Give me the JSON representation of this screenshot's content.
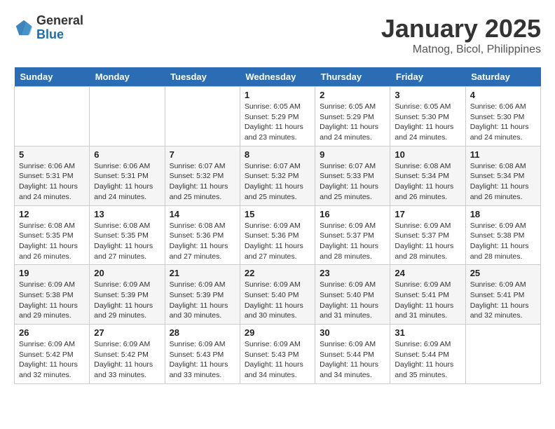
{
  "header": {
    "logo": {
      "line1": "General",
      "line2": "Blue"
    },
    "title": "January 2025",
    "location": "Matnog, Bicol, Philippines"
  },
  "weekdays": [
    "Sunday",
    "Monday",
    "Tuesday",
    "Wednesday",
    "Thursday",
    "Friday",
    "Saturday"
  ],
  "weeks": [
    [
      {
        "day": "",
        "sunrise": "",
        "sunset": "",
        "daylight": ""
      },
      {
        "day": "",
        "sunrise": "",
        "sunset": "",
        "daylight": ""
      },
      {
        "day": "",
        "sunrise": "",
        "sunset": "",
        "daylight": ""
      },
      {
        "day": "1",
        "sunrise": "Sunrise: 6:05 AM",
        "sunset": "Sunset: 5:29 PM",
        "daylight": "Daylight: 11 hours and 23 minutes."
      },
      {
        "day": "2",
        "sunrise": "Sunrise: 6:05 AM",
        "sunset": "Sunset: 5:29 PM",
        "daylight": "Daylight: 11 hours and 24 minutes."
      },
      {
        "day": "3",
        "sunrise": "Sunrise: 6:05 AM",
        "sunset": "Sunset: 5:30 PM",
        "daylight": "Daylight: 11 hours and 24 minutes."
      },
      {
        "day": "4",
        "sunrise": "Sunrise: 6:06 AM",
        "sunset": "Sunset: 5:30 PM",
        "daylight": "Daylight: 11 hours and 24 minutes."
      }
    ],
    [
      {
        "day": "5",
        "sunrise": "Sunrise: 6:06 AM",
        "sunset": "Sunset: 5:31 PM",
        "daylight": "Daylight: 11 hours and 24 minutes."
      },
      {
        "day": "6",
        "sunrise": "Sunrise: 6:06 AM",
        "sunset": "Sunset: 5:31 PM",
        "daylight": "Daylight: 11 hours and 24 minutes."
      },
      {
        "day": "7",
        "sunrise": "Sunrise: 6:07 AM",
        "sunset": "Sunset: 5:32 PM",
        "daylight": "Daylight: 11 hours and 25 minutes."
      },
      {
        "day": "8",
        "sunrise": "Sunrise: 6:07 AM",
        "sunset": "Sunset: 5:32 PM",
        "daylight": "Daylight: 11 hours and 25 minutes."
      },
      {
        "day": "9",
        "sunrise": "Sunrise: 6:07 AM",
        "sunset": "Sunset: 5:33 PM",
        "daylight": "Daylight: 11 hours and 25 minutes."
      },
      {
        "day": "10",
        "sunrise": "Sunrise: 6:08 AM",
        "sunset": "Sunset: 5:34 PM",
        "daylight": "Daylight: 11 hours and 26 minutes."
      },
      {
        "day": "11",
        "sunrise": "Sunrise: 6:08 AM",
        "sunset": "Sunset: 5:34 PM",
        "daylight": "Daylight: 11 hours and 26 minutes."
      }
    ],
    [
      {
        "day": "12",
        "sunrise": "Sunrise: 6:08 AM",
        "sunset": "Sunset: 5:35 PM",
        "daylight": "Daylight: 11 hours and 26 minutes."
      },
      {
        "day": "13",
        "sunrise": "Sunrise: 6:08 AM",
        "sunset": "Sunset: 5:35 PM",
        "daylight": "Daylight: 11 hours and 27 minutes."
      },
      {
        "day": "14",
        "sunrise": "Sunrise: 6:08 AM",
        "sunset": "Sunset: 5:36 PM",
        "daylight": "Daylight: 11 hours and 27 minutes."
      },
      {
        "day": "15",
        "sunrise": "Sunrise: 6:09 AM",
        "sunset": "Sunset: 5:36 PM",
        "daylight": "Daylight: 11 hours and 27 minutes."
      },
      {
        "day": "16",
        "sunrise": "Sunrise: 6:09 AM",
        "sunset": "Sunset: 5:37 PM",
        "daylight": "Daylight: 11 hours and 28 minutes."
      },
      {
        "day": "17",
        "sunrise": "Sunrise: 6:09 AM",
        "sunset": "Sunset: 5:37 PM",
        "daylight": "Daylight: 11 hours and 28 minutes."
      },
      {
        "day": "18",
        "sunrise": "Sunrise: 6:09 AM",
        "sunset": "Sunset: 5:38 PM",
        "daylight": "Daylight: 11 hours and 28 minutes."
      }
    ],
    [
      {
        "day": "19",
        "sunrise": "Sunrise: 6:09 AM",
        "sunset": "Sunset: 5:38 PM",
        "daylight": "Daylight: 11 hours and 29 minutes."
      },
      {
        "day": "20",
        "sunrise": "Sunrise: 6:09 AM",
        "sunset": "Sunset: 5:39 PM",
        "daylight": "Daylight: 11 hours and 29 minutes."
      },
      {
        "day": "21",
        "sunrise": "Sunrise: 6:09 AM",
        "sunset": "Sunset: 5:39 PM",
        "daylight": "Daylight: 11 hours and 30 minutes."
      },
      {
        "day": "22",
        "sunrise": "Sunrise: 6:09 AM",
        "sunset": "Sunset: 5:40 PM",
        "daylight": "Daylight: 11 hours and 30 minutes."
      },
      {
        "day": "23",
        "sunrise": "Sunrise: 6:09 AM",
        "sunset": "Sunset: 5:40 PM",
        "daylight": "Daylight: 11 hours and 31 minutes."
      },
      {
        "day": "24",
        "sunrise": "Sunrise: 6:09 AM",
        "sunset": "Sunset: 5:41 PM",
        "daylight": "Daylight: 11 hours and 31 minutes."
      },
      {
        "day": "25",
        "sunrise": "Sunrise: 6:09 AM",
        "sunset": "Sunset: 5:41 PM",
        "daylight": "Daylight: 11 hours and 32 minutes."
      }
    ],
    [
      {
        "day": "26",
        "sunrise": "Sunrise: 6:09 AM",
        "sunset": "Sunset: 5:42 PM",
        "daylight": "Daylight: 11 hours and 32 minutes."
      },
      {
        "day": "27",
        "sunrise": "Sunrise: 6:09 AM",
        "sunset": "Sunset: 5:42 PM",
        "daylight": "Daylight: 11 hours and 33 minutes."
      },
      {
        "day": "28",
        "sunrise": "Sunrise: 6:09 AM",
        "sunset": "Sunset: 5:43 PM",
        "daylight": "Daylight: 11 hours and 33 minutes."
      },
      {
        "day": "29",
        "sunrise": "Sunrise: 6:09 AM",
        "sunset": "Sunset: 5:43 PM",
        "daylight": "Daylight: 11 hours and 34 minutes."
      },
      {
        "day": "30",
        "sunrise": "Sunrise: 6:09 AM",
        "sunset": "Sunset: 5:44 PM",
        "daylight": "Daylight: 11 hours and 34 minutes."
      },
      {
        "day": "31",
        "sunrise": "Sunrise: 6:09 AM",
        "sunset": "Sunset: 5:44 PM",
        "daylight": "Daylight: 11 hours and 35 minutes."
      },
      {
        "day": "",
        "sunrise": "",
        "sunset": "",
        "daylight": ""
      }
    ]
  ]
}
